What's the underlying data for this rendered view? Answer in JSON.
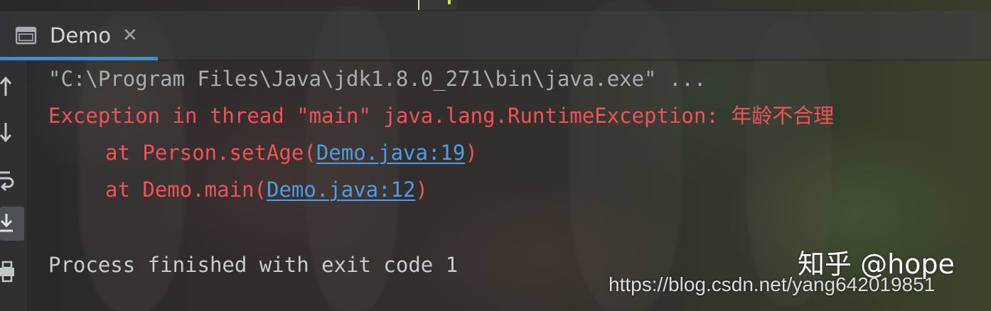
{
  "tab": {
    "label": "Demo",
    "close_glyph": "✕",
    "icon": "console-window-icon",
    "active_color": "#4a88c7"
  },
  "gutter": {
    "buttons": [
      {
        "icon": "arrow-up-icon"
      },
      {
        "icon": "arrow-down-icon"
      },
      {
        "icon": "soft-wrap-icon"
      },
      {
        "icon": "scroll-to-end-icon",
        "active": true
      },
      {
        "icon": "print-icon"
      }
    ]
  },
  "console": {
    "command_line": "\"C:\\Program Files\\Java\\jdk1.8.0_271\\bin\\java.exe\" ...",
    "exception_prefix": "Exception in thread \"main\" java.lang.RuntimeException: ",
    "exception_message": "年龄不合理",
    "frames": [
      {
        "prefix": "at Person.setAge(",
        "link": "Demo.java:19",
        "suffix": ")"
      },
      {
        "prefix": "at Demo.main(",
        "link": "Demo.java:12",
        "suffix": ")"
      }
    ],
    "exit_line": "Process finished with exit code 1",
    "colors": {
      "command": "#a9adb0",
      "error": "#f0525a",
      "link": "#4f9be8",
      "normal": "#c9cccf"
    }
  },
  "watermarks": {
    "zhihu": "知乎 @hope",
    "csdn": "https://blog.csdn.net/yang642019851"
  }
}
